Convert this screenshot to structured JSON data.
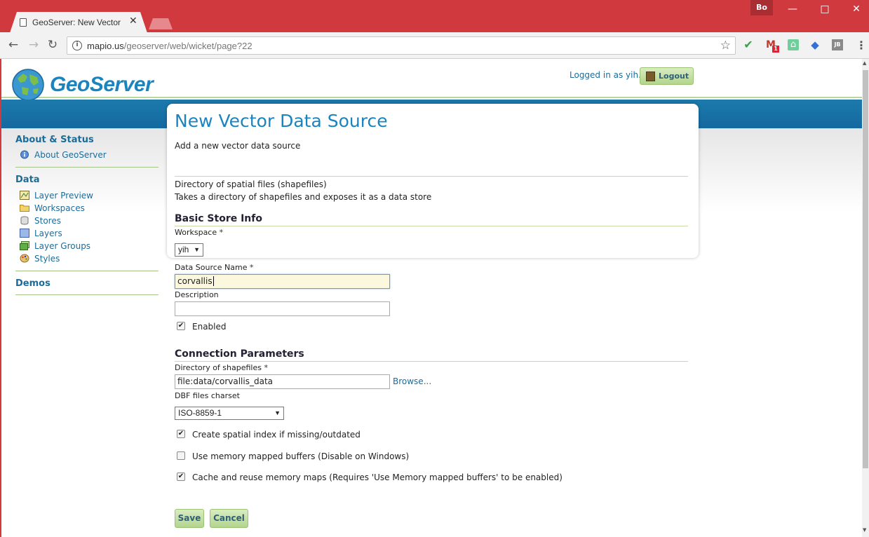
{
  "browser": {
    "tab_title": "GeoServer: New Vector D",
    "tab_close": "✕",
    "profile": "Bo",
    "url_host": "mapio.us",
    "url_path": "/geoserver/web/wicket/page?22",
    "gmail_badge": "1",
    "ext_jb": "JB"
  },
  "header": {
    "logo_text": "GeoServer",
    "logged_in": "Logged in as yih.",
    "logout_label": "Logout"
  },
  "sidebar": {
    "about_heading": "About & Status",
    "about_item": "About GeoServer",
    "data_heading": "Data",
    "data_items": [
      "Layer Preview",
      "Workspaces",
      "Stores",
      "Layers",
      "Layer Groups",
      "Styles"
    ],
    "demos_heading": "Demos"
  },
  "form": {
    "title": "New Vector Data Source",
    "subtitle": "Add a new vector data source",
    "store_type": "Directory of spatial files (shapefiles)",
    "store_desc": "Takes a directory of shapefiles and exposes it as a data store",
    "basic_heading": "Basic Store Info",
    "workspace_label": "Workspace",
    "workspace_value": "yih",
    "name_label": "Data Source Name",
    "name_value": "corvallis",
    "description_label": "Description",
    "description_value": "",
    "enabled_label": "Enabled",
    "enabled": true,
    "required_mark": "*",
    "conn_heading": "Connection Parameters",
    "dir_label": "Directory of shapefiles",
    "dir_value": "file:data/corvallis_data",
    "browse": "Browse...",
    "charset_label": "DBF files charset",
    "charset_value": "ISO-8859-1",
    "opt_spatial_index": "Create spatial index if missing/outdated",
    "opt_spatial_index_checked": true,
    "opt_memory_mapped": "Use memory mapped buffers (Disable on Windows)",
    "opt_memory_mapped_checked": false,
    "opt_cache": "Cache and reuse memory maps (Requires 'Use Memory mapped buffers' to be enabled)",
    "opt_cache_checked": true,
    "save": "Save",
    "cancel": "Cancel"
  },
  "colors": {
    "chrome_red": "#d03a3f",
    "link_blue": "#1c6c9a",
    "title_blue": "#1b84bf",
    "button_green": "#b3d58e"
  }
}
